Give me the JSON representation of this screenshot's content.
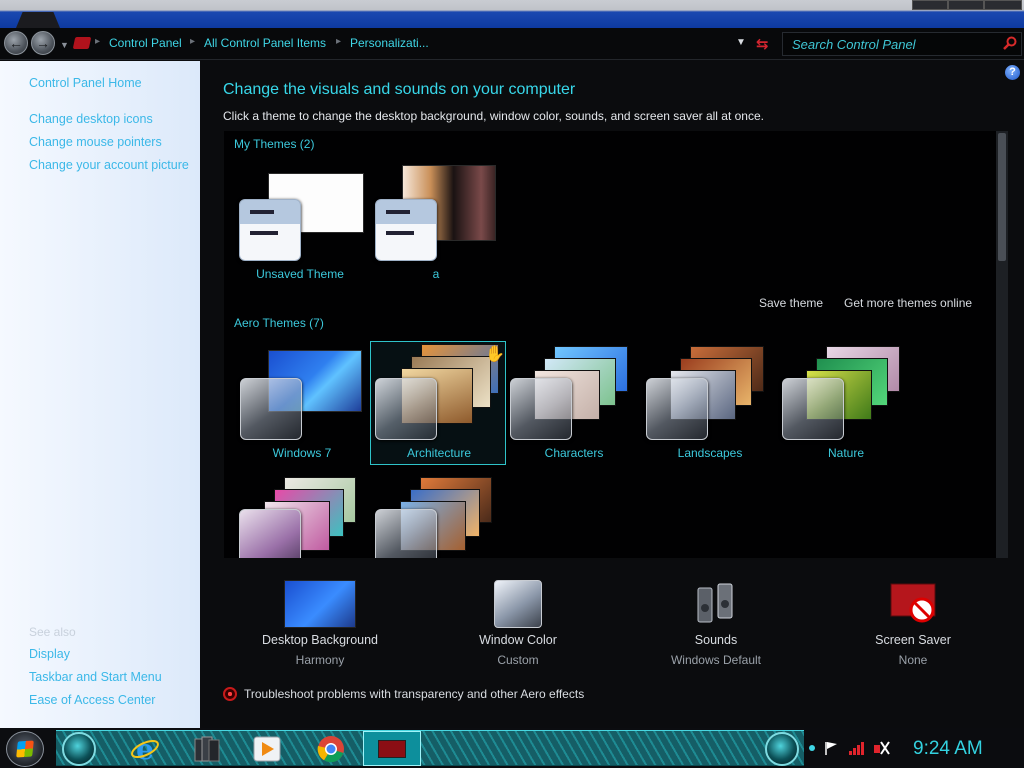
{
  "address_bar": {
    "crumbs": [
      "Control Panel",
      "All Control Panel Items",
      "Personalizati..."
    ],
    "search_placeholder": "Search Control Panel"
  },
  "nav": {
    "home": "Control Panel Home",
    "links": [
      "Change desktop icons",
      "Change mouse pointers",
      "Change your account picture"
    ],
    "see_also_label": "See also",
    "see_also": [
      "Display",
      "Taskbar and Start Menu",
      "Ease of Access Center"
    ]
  },
  "content": {
    "title": "Change the visuals and sounds on your computer",
    "subtitle": "Click a theme to change the desktop background, window color, sounds, and screen saver all at once.",
    "my_themes_header": "My Themes (2)",
    "my_themes": [
      "Unsaved Theme",
      "a"
    ],
    "save_theme": "Save theme",
    "get_more": "Get more themes online",
    "aero_header": "Aero Themes (7)",
    "aero_themes": [
      "Windows 7",
      "Architecture",
      "Characters",
      "Landscapes",
      "Nature",
      "",
      ""
    ],
    "selected_theme": "Architecture",
    "settings": [
      {
        "name": "Desktop Background",
        "value": "Harmony"
      },
      {
        "name": "Window Color",
        "value": "Custom"
      },
      {
        "name": "Sounds",
        "value": "Windows Default"
      },
      {
        "name": "Screen Saver",
        "value": "None"
      }
    ],
    "troubleshoot": "Troubleshoot problems with transparency and other Aero effects"
  },
  "taskbar": {
    "clock": "9:24 AM",
    "pinned": [
      "internet-explorer-icon",
      "folders-icon",
      "media-player-icon",
      "chrome-icon",
      "control-panel-icon"
    ]
  },
  "colors": {
    "accent": "#38d8ea",
    "nav_link": "#3bb8e8",
    "taskbar": "#186f78"
  }
}
